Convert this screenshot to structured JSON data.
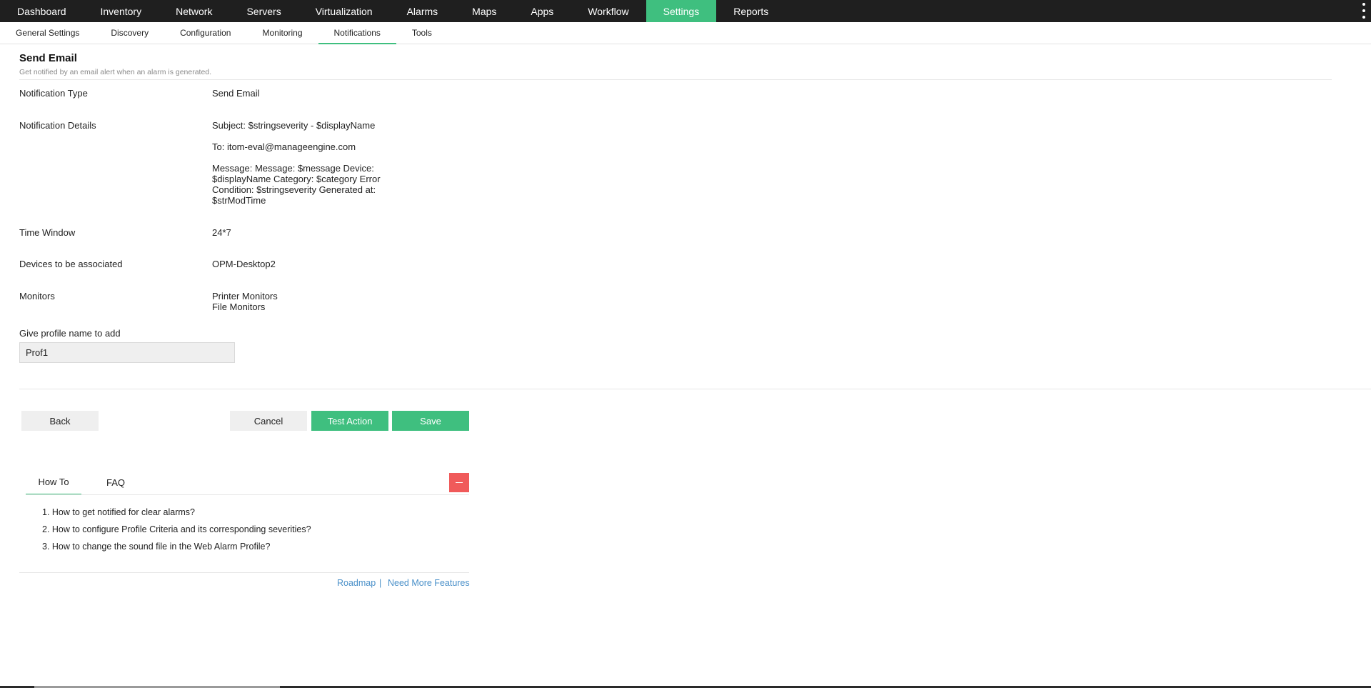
{
  "topnav": {
    "items": [
      "Dashboard",
      "Inventory",
      "Network",
      "Servers",
      "Virtualization",
      "Alarms",
      "Maps",
      "Apps",
      "Workflow",
      "Settings",
      "Reports"
    ],
    "active": "Settings",
    "accent_color": "#3fbf7f"
  },
  "subnav": {
    "items": [
      "General Settings",
      "Discovery",
      "Configuration",
      "Monitoring",
      "Notifications",
      "Tools"
    ],
    "active": "Notifications"
  },
  "page": {
    "title": "Send Email",
    "subtitle": "Get notified by an email alert when an alarm is generated."
  },
  "details": {
    "notification_type_label": "Notification Type",
    "notification_type_value": "Send Email",
    "notification_details_label": "Notification Details",
    "subject": "Subject: $stringseverity - $displayName",
    "to": "To: itom-eval@manageengine.com",
    "message_lines": [
      "Message: Message: $message Device:",
      "$displayName Category: $category Error",
      "Condition: $stringseverity Generated at:",
      "$strModTime"
    ],
    "time_window_label": "Time Window",
    "time_window_value": "24*7",
    "devices_label": "Devices to be associated",
    "devices_value": "OPM-Desktop2",
    "monitors_label": "Monitors",
    "monitors_values": [
      "Printer Monitors",
      "File Monitors"
    ]
  },
  "profile": {
    "label": "Give profile name to add",
    "value": "Prof1"
  },
  "buttons": {
    "back": "Back",
    "cancel": "Cancel",
    "test_action": "Test Action",
    "save": "Save"
  },
  "help": {
    "tabs": [
      "How To",
      "FAQ"
    ],
    "active_tab": "How To",
    "items": [
      "1. How to get notified for clear alarms?",
      "2. How to configure Profile Criteria and its corresponding severities?",
      "3. How to change the sound file in the Web Alarm Profile?"
    ],
    "collapse_color": "#f05a5a"
  },
  "footer": {
    "roadmap": "Roadmap",
    "separator": "|",
    "need_more": "Need More Features",
    "link_color": "#4a90c9"
  }
}
